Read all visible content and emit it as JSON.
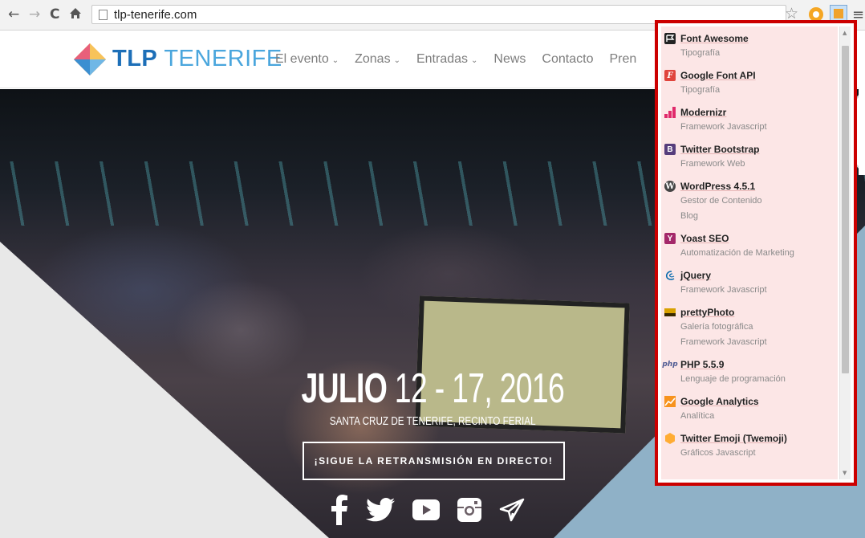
{
  "browser": {
    "url": "tlp-tenerife.com",
    "nav_back": "←",
    "nav_forward": "→",
    "nav_reload": "C",
    "nav_home": "🏠"
  },
  "site": {
    "logo_bold": "TLP",
    "logo_light": "TENERIFE",
    "nav": [
      {
        "label": "El evento",
        "dropdown": "⌄"
      },
      {
        "label": "Zonas",
        "dropdown": "⌄"
      },
      {
        "label": "Entradas",
        "dropdown": "⌄"
      },
      {
        "label": "News",
        "dropdown": ""
      },
      {
        "label": "Contacto",
        "dropdown": ""
      },
      {
        "label": "Pren",
        "dropdown": ""
      }
    ]
  },
  "hero": {
    "date_bold": "JULIO",
    "date_rest": "12 - 17, 2016",
    "venue": "SANTA CRUZ DE TENERIFE, RECINTO FERIAL",
    "button_label": "¡SIGUE LA RETRANSMISIÓN EN DIRECTO!",
    "socials": [
      "facebook-icon",
      "twitter-icon",
      "youtube-icon",
      "instagram-icon",
      "paper-plane-icon"
    ]
  },
  "technologies": [
    {
      "name": "Font Awesome",
      "categories": [
        "Tipografía"
      ],
      "icon": "font-awesome-icon",
      "color": "#222222"
    },
    {
      "name": "Google Font API",
      "categories": [
        "Tipografía"
      ],
      "icon": "google-font-api-icon",
      "color": "#e0443c"
    },
    {
      "name": "Modernizr",
      "categories": [
        "Framework Javascript"
      ],
      "icon": "modernizr-icon",
      "color": "#e02a6b"
    },
    {
      "name": "Twitter Bootstrap",
      "categories": [
        "Framework Web"
      ],
      "icon": "bootstrap-icon",
      "color": "#563d7c"
    },
    {
      "name": "WordPress 4.5.1",
      "categories": [
        "Gestor de Contenido",
        "Blog"
      ],
      "icon": "wordpress-icon",
      "color": "#464646"
    },
    {
      "name": "Yoast SEO",
      "categories": [
        "Automatización de Marketing"
      ],
      "icon": "yoast-icon",
      "color": "#a4286a"
    },
    {
      "name": "jQuery",
      "categories": [
        "Framework Javascript"
      ],
      "icon": "jquery-icon",
      "color": "#0769ad"
    },
    {
      "name": "prettyPhoto",
      "categories": [
        "Galería fotográfica",
        "Framework Javascript"
      ],
      "icon": "prettyphoto-icon",
      "color": "#d8a100"
    },
    {
      "name": "PHP 5.5.9",
      "categories": [
        "Lenguaje de programación"
      ],
      "icon": "php-icon",
      "color": "#4f5b93"
    },
    {
      "name": "Google Analytics",
      "categories": [
        "Analítica"
      ],
      "icon": "google-analytics-icon",
      "color": "#f7931e"
    },
    {
      "name": "Twitter Emoji (Twemoji)",
      "categories": [
        "Gráficos Javascript"
      ],
      "icon": "twemoji-icon",
      "color": "#ffac33"
    }
  ]
}
